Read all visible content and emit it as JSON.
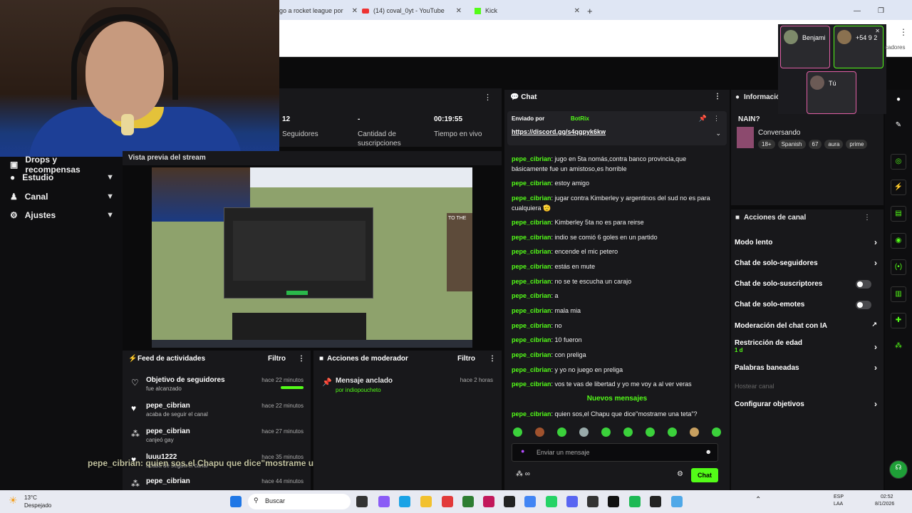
{
  "tabs": [
    {
      "label": "go a rocket league por"
    },
    {
      "label": "(14) coval_0yt - YouTube"
    },
    {
      "label": "Kick"
    }
  ],
  "new_tab": "+",
  "stats": {
    "followers_value": "12",
    "followers_label": "Seguidores",
    "subs_value": "-",
    "subs_label": "Cantidad de suscripciones",
    "live_value": "00:19:55",
    "live_label": "Tiempo en vivo"
  },
  "sidebar": {
    "items": [
      {
        "label": "Drops y recompensas"
      },
      {
        "label": "Estudio"
      },
      {
        "label": "Canal"
      },
      {
        "label": "Ajustes"
      }
    ]
  },
  "preview": {
    "title": "Vista previa del stream",
    "side_text": "TO THE"
  },
  "feed": {
    "title": "Feed de actividades",
    "filter": "Filtro",
    "items": [
      {
        "title": "Objetivo de seguidores",
        "sub": "fue alcanzado",
        "time": "hace 22 minutos"
      },
      {
        "title": "pepe_cibrian",
        "sub": "acaba de seguir el canal",
        "time": "hace 22 minutos"
      },
      {
        "title": "pepe_cibrian",
        "sub": "canjeó gay",
        "time": "hace 27 minutos"
      },
      {
        "title": "luuu1222",
        "sub": "acaba de seguir el canal",
        "time": "hace 35 minutos"
      },
      {
        "title": "pepe_cibrian",
        "sub": "",
        "time": "hace 44 minutos"
      }
    ]
  },
  "overlay_caption": "pepe_cibrian: quien sos,el Chapu que dice\"mostrame una teta\"?",
  "modact": {
    "title": "Acciones de moderador",
    "filter": "Filtro",
    "item_title": "Mensaje anclado",
    "item_by": "por indiopoucheto",
    "item_time": "hace 2 horas"
  },
  "chat": {
    "title": "Chat",
    "pinned_by": "Enviado por",
    "pinned_bot": "BotRix",
    "pinned_link": "https://discord.gg/s4qgpyk6kw",
    "messages": [
      {
        "user": "pepe_cibrian",
        "text": "jugo en 5ta nomás,contra banco provincia,que básicamente fue un amistoso,es horrible"
      },
      {
        "user": "pepe_cibrian",
        "text": "estoy amigo"
      },
      {
        "user": "pepe_cibrian",
        "text": "jugar contra Kimberley y argentinos del sud no es para cualquiera 🫡"
      },
      {
        "user": "pepe_cibrian",
        "text": "Kimberley 5ta no es para reirse"
      },
      {
        "user": "pepe_cibrian",
        "text": "indio se comió 6 goles en un partido"
      },
      {
        "user": "pepe_cibrian",
        "text": "encende el mic petero"
      },
      {
        "user": "pepe_cibrian",
        "text": "estás en mute"
      },
      {
        "user": "pepe_cibrian",
        "text": "no se te escucha un carajo"
      },
      {
        "user": "pepe_cibrian",
        "text": "a"
      },
      {
        "user": "pepe_cibrian",
        "text": "mala mia"
      },
      {
        "user": "pepe_cibrian",
        "text": "no"
      },
      {
        "user": "pepe_cibrian",
        "text": "10 fueron"
      },
      {
        "user": "pepe_cibrian",
        "text": "con preliga"
      },
      {
        "user": "pepe_cibrian",
        "text": "y yo no juego en preliga"
      },
      {
        "user": "pepe_cibrian",
        "text": "vos te vas de libertad y yo me voy a al ver veras"
      }
    ],
    "new_messages": "Nuevos mensajes",
    "last": {
      "user": "pepe_cibrian",
      "text": "quien sos,el Chapu que dice\"mostrame una teta\"?"
    },
    "input_placeholder": "Enviar un mensaje",
    "send": "Chat"
  },
  "info": {
    "title": "Informació",
    "stream_title": "NAIN?",
    "category": "Conversando",
    "tags": [
      "18+",
      "Spanish",
      "67",
      "aura",
      "prime"
    ]
  },
  "acciones": {
    "title": "Acciones de canal",
    "items": [
      {
        "label": "Modo lento"
      },
      {
        "label": "Chat de solo-seguidores"
      },
      {
        "label": "Chat de solo-suscriptores"
      },
      {
        "label": "Chat de solo-emotes"
      },
      {
        "label": "Moderación del chat con IA"
      },
      {
        "label": "Restricción de edad",
        "sub": "1 d"
      },
      {
        "label": "Palabras baneadas"
      },
      {
        "label": "Hostear canal"
      },
      {
        "label": "Configurar objetivos"
      }
    ]
  },
  "call": {
    "p1": "Benjami",
    "p2": "+54 9 2",
    "me": "Tú",
    "side": "cadores"
  },
  "taskbar": {
    "temp": "13°C",
    "weather": "Despejado",
    "search": "Buscar",
    "lang1": "ESP",
    "lang2": "LAA",
    "time": "02:52",
    "date": "8/1/2026"
  },
  "colors": {
    "accent": "#53fc18",
    "panel": "#18181b",
    "call_border": "#e05fa5"
  }
}
